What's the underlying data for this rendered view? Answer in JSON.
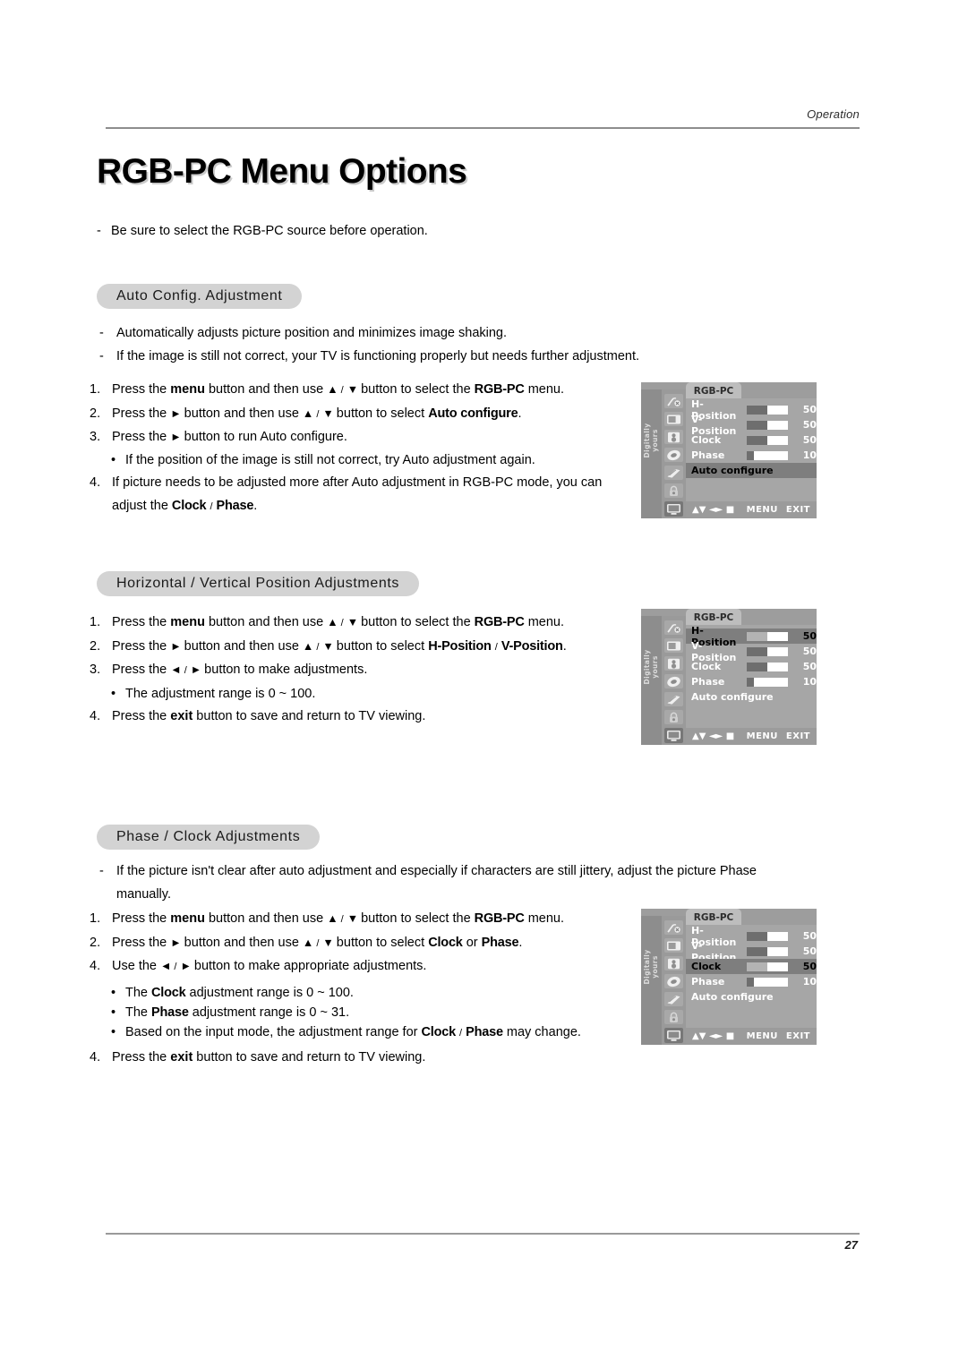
{
  "header": {
    "running_head": "Operation"
  },
  "title": "RGB-PC Menu Options",
  "intro": {
    "dash": "-",
    "text": "Be sure to select the RGB-PC source before operation."
  },
  "sections": [
    {
      "heading": "Auto Config. Adjustment",
      "notes": [
        "Automatically adjusts picture position and minimizes image shaking.",
        "If the image is still not correct, your TV is functioning properly but needs further adjustment."
      ],
      "steps": [
        {
          "num": "1.",
          "text": "Press the menu button and then use ▲ / ▼ button to select the RGB-PC menu."
        },
        {
          "num": "2.",
          "text": "Press the ► button and then use ▲ / ▼ button to select Auto configure."
        },
        {
          "num": "3.",
          "text": "Press the ► button to run Auto configure."
        },
        {
          "bullet": "•",
          "text": "If the position of the image is still not correct, try Auto adjustment again."
        },
        {
          "num": "4.",
          "text": "If picture needs to be adjusted more after Auto adjustment in RGB-PC mode, you can adjust the Clock / Phase."
        }
      ]
    },
    {
      "heading": "Horizontal / Vertical Position Adjustments",
      "steps": [
        {
          "num": "1.",
          "text": "Press the menu button and then use ▲ / ▼ button to select the RGB-PC menu."
        },
        {
          "num": "2.",
          "text": "Press the ► button and then use ▲ / ▼ button to select H-Position / V-Position."
        },
        {
          "num": "3.",
          "text": "Press the ◄ / ► button to make adjustments."
        },
        {
          "bullet": "•",
          "text": "The adjustment range is 0 ~ 100."
        },
        {
          "num": "4.",
          "text": "Press the exit button to save and return to TV viewing."
        }
      ]
    },
    {
      "heading": "Phase / Clock Adjustments",
      "notes": [
        "If the picture isn't clear after auto adjustment and especially if characters are still jittery, adjust the picture Phase manually."
      ],
      "steps": [
        {
          "num": "1.",
          "text": "Press the menu button and then use ▲ / ▼ button to select the RGB-PC menu."
        },
        {
          "num": "2.",
          "text": "Press the ► button and then use ▲ / ▼ button to select Clock or Phase."
        },
        {
          "num": "4.",
          "text": "Use the ◄ / ► button to make appropriate adjustments."
        },
        {
          "bullet": "•",
          "text": "The Clock adjustment range is 0 ~ 100."
        },
        {
          "bullet": "•",
          "text": "The Phase adjustment range is 0 ~ 31."
        },
        {
          "bullet": "•",
          "text": "Based on the input mode, the adjustment range for Clock / Phase may change."
        },
        {
          "num": "4.",
          "text": "Press the exit button to save and return to TV viewing."
        }
      ]
    }
  ],
  "osd": {
    "brand": "Digitally yours",
    "tab_label": "RGB-PC",
    "items": [
      {
        "label": "H-Position",
        "value": "50",
        "fill_pct": 50
      },
      {
        "label": "V-Position",
        "value": "50",
        "fill_pct": 50
      },
      {
        "label": "Clock",
        "value": "50",
        "fill_pct": 50
      },
      {
        "label": "Phase",
        "value": "10",
        "fill_pct": 18
      }
    ],
    "auto_label": "Auto configure",
    "nav": {
      "glyphs": "▲▼ ◄► ■",
      "menu": "MENU",
      "exit": "EXIT"
    },
    "sidebar_icons": [
      "antenna-off-icon",
      "picture-icon",
      "audio-icon",
      "time-icon",
      "special-icon",
      "lock-icon",
      "screen-icon"
    ],
    "instances": [
      {
        "name": "osd-auto-configure",
        "highlight": "auto"
      },
      {
        "name": "osd-h-position",
        "highlight": "H-Position"
      },
      {
        "name": "osd-clock",
        "highlight": "Clock"
      }
    ]
  },
  "footer": {
    "page_number": "27"
  }
}
